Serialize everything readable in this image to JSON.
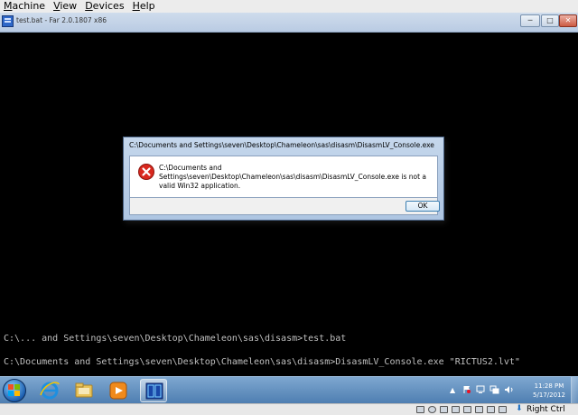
{
  "host_menu": [
    {
      "underline": "M",
      "rest": "achine"
    },
    {
      "underline": "V",
      "rest": "iew"
    },
    {
      "underline": "D",
      "rest": "evices"
    },
    {
      "underline": "H",
      "rest": "elp"
    }
  ],
  "window": {
    "title": "test.bat - Far 2.0.1807 x86",
    "min_glyph": "─",
    "max_glyph": "□",
    "close_glyph": "✕"
  },
  "console": {
    "line1": "C:\\... and Settings\\seven\\Desktop\\Chameleon\\sas\\disasm>test.bat",
    "line2": "C:\\Documents and Settings\\seven\\Desktop\\Chameleon\\sas\\disasm>DisasmLV_Console.exe \"RICTUS2.lvt\""
  },
  "dialog": {
    "title": "C:\\Documents and Settings\\seven\\Desktop\\Chameleon\\sas\\disasm\\DisasmLV_Console.exe",
    "message": "C:\\Documents and Settings\\seven\\Desktop\\Chameleon\\sas\\disasm\\DisasmLV_Console.exe is not a valid Win32 application.",
    "ok_label": "OK",
    "icon": "error-icon"
  },
  "taskbar": {
    "pinned": [
      "internet-explorer-icon",
      "windows-explorer-icon",
      "media-player-icon",
      "far-manager-icon"
    ],
    "tray_icons": [
      "show-hidden-icons-icon",
      "action-center-flag-icon",
      "display-icon",
      "network-icon",
      "volume-icon"
    ],
    "clock_time": "11:28 PM",
    "clock_date": "5/17/2012"
  },
  "vbox_status": {
    "host_key": "Right Ctrl"
  },
  "colors": {
    "console_bg": "#000000",
    "console_text": "#c0c0c0",
    "error_red": "#d9281e"
  }
}
